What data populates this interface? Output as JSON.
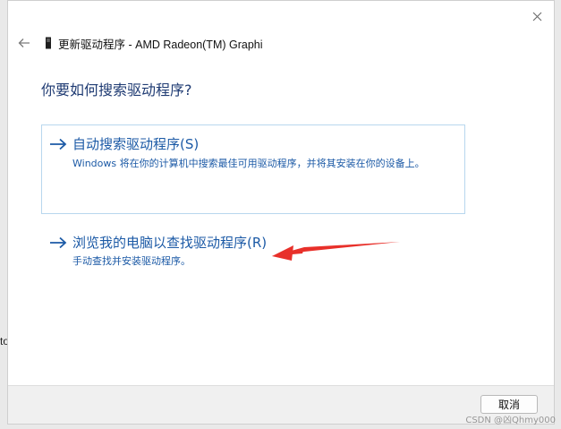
{
  "background": {
    "edge_text": "to"
  },
  "dialog": {
    "title": "更新驱动程序 - AMD Radeon(TM) Graphi",
    "heading": "你要如何搜索驱动程序?",
    "options": [
      {
        "title": "自动搜索驱动程序(S)",
        "description": "Windows 将在你的计算机中搜索最佳可用驱动程序，并将其安装在你的设备上。"
      },
      {
        "title": "浏览我的电脑以查找驱动程序(R)",
        "description": "手动查找并安装驱动程序。"
      }
    ],
    "cancel_label": "取消"
  },
  "icons": {
    "close": "close-icon",
    "back": "back-arrow-icon",
    "device": "device-icon",
    "option_arrow": "right-arrow-icon"
  },
  "colors": {
    "heading": "#1f3b73",
    "link": "#1c5aa6",
    "annotation": "#e8302a",
    "option_border": "#b8d7ee"
  },
  "watermark": "CSDN @凶Qhmy000"
}
